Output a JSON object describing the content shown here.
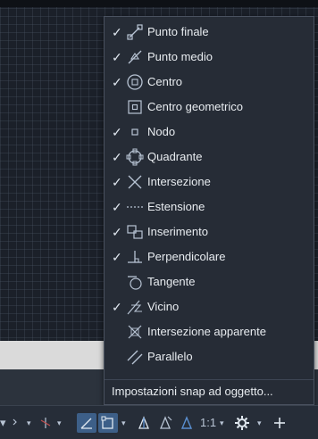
{
  "menu": {
    "items": [
      {
        "label": "Punto finale",
        "checked": true,
        "icon": "endpoint-icon"
      },
      {
        "label": "Punto medio",
        "checked": true,
        "icon": "midpoint-icon"
      },
      {
        "label": "Centro",
        "checked": true,
        "icon": "center-icon"
      },
      {
        "label": "Centro geometrico",
        "checked": false,
        "icon": "geometric-center-icon"
      },
      {
        "label": "Nodo",
        "checked": true,
        "icon": "node-icon"
      },
      {
        "label": "Quadrante",
        "checked": true,
        "icon": "quadrant-icon"
      },
      {
        "label": "Intersezione",
        "checked": true,
        "icon": "intersection-icon"
      },
      {
        "label": "Estensione",
        "checked": true,
        "icon": "extension-icon"
      },
      {
        "label": "Inserimento",
        "checked": true,
        "icon": "insertion-icon"
      },
      {
        "label": "Perpendicolare",
        "checked": true,
        "icon": "perpendicular-icon"
      },
      {
        "label": "Tangente",
        "checked": false,
        "icon": "tangent-icon"
      },
      {
        "label": "Vicino",
        "checked": true,
        "icon": "nearest-icon"
      },
      {
        "label": "Intersezione apparente",
        "checked": false,
        "icon": "apparent-intersection-icon"
      },
      {
        "label": "Parallelo",
        "checked": false,
        "icon": "parallel-icon"
      }
    ],
    "settings_label": "Impostazioni snap ad oggetto...",
    "check_glyph": "✓"
  },
  "statusbar": {
    "scale_label": "1:1",
    "caret": "▾"
  },
  "colors": {
    "menu_bg": "#262c36",
    "accent": "#3d5f88",
    "text": "#e8ecf0",
    "icon": "#b8c4d4"
  }
}
